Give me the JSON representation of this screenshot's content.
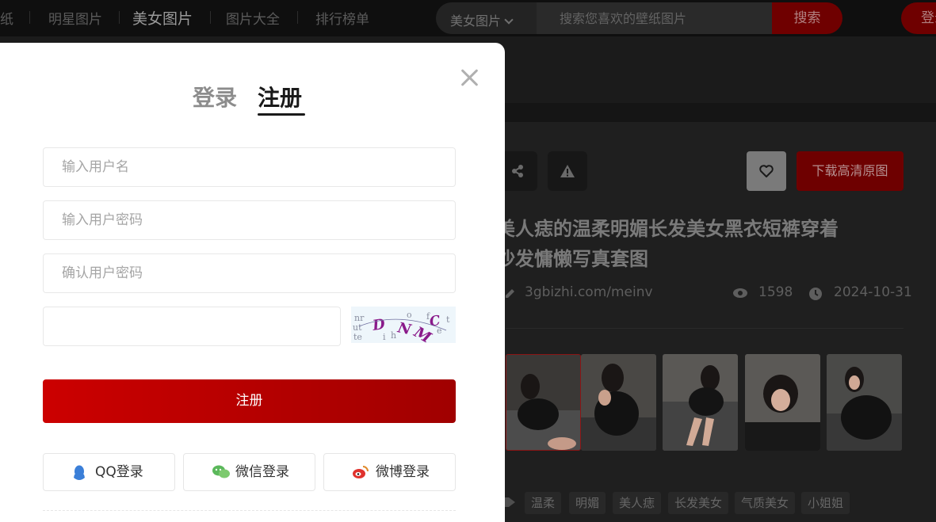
{
  "nav": {
    "items": [
      "纸",
      "明星图片",
      "美女图片",
      "图片大全",
      "排行榜单"
    ]
  },
  "search": {
    "category": "美女图片",
    "placeholder": "搜索您喜欢的壁纸图片",
    "button": "搜索"
  },
  "header": {
    "login": "登录"
  },
  "modal": {
    "tabs": {
      "login": "登录",
      "register": "注册"
    },
    "active_tab": "注册",
    "username_placeholder": "输入用户名",
    "password_placeholder": "输入用户密码",
    "confirm_placeholder": "确认用户密码",
    "captcha_value": "",
    "captcha_text": "DNMC",
    "submit": "注册",
    "social": {
      "qq": "QQ登录",
      "wechat": "微信登录",
      "weibo": "微博登录"
    }
  },
  "detail": {
    "download_button": "下载高清原图",
    "title_line1": "根底美人痣的温柔明媚长发美女黑衣短裤穿着",
    "title_line2": "私房沙发慵懒写真套图",
    "source": "3gbizhi.com/meinv",
    "views": "1598",
    "date": "2024-10-31",
    "tags": [
      "温柔",
      "明媚",
      "美人痣",
      "长发美女",
      "气质美女",
      "小姐姐"
    ]
  },
  "colors": {
    "accent": "#cc0000",
    "accent_dark": "#6f0000",
    "page_bg": "#151515"
  }
}
